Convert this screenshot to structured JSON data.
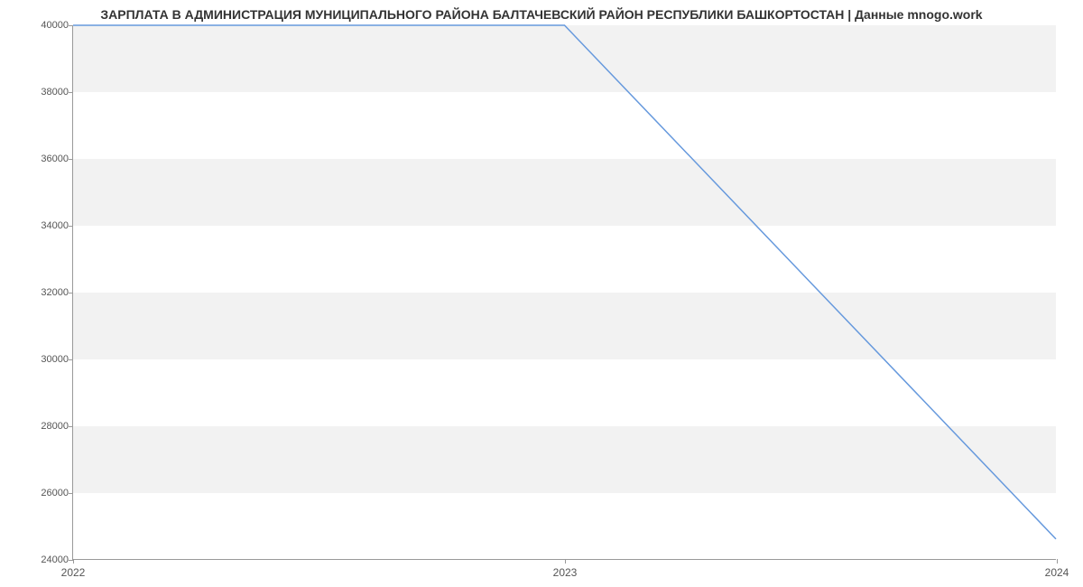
{
  "chart_data": {
    "type": "line",
    "title": "ЗАРПЛАТА В АДМИНИСТРАЦИЯ МУНИЦИПАЛЬНОГО РАЙОНА БАЛТАЧЕВСКИЙ РАЙОН РЕСПУБЛИКИ БАШКОРТОСТАН | Данные mnogo.work",
    "x": [
      2022,
      2023,
      2024
    ],
    "values": [
      40000,
      40000,
      24600
    ],
    "xlabel": "",
    "ylabel": "",
    "xlim": [
      2022,
      2024
    ],
    "ylim": [
      24000,
      40000
    ],
    "x_ticks": [
      2022,
      2023,
      2024
    ],
    "y_ticks": [
      24000,
      26000,
      28000,
      30000,
      32000,
      34000,
      36000,
      38000,
      40000
    ],
    "line_color": "#6699dd",
    "band_color": "#f2f2f2"
  }
}
